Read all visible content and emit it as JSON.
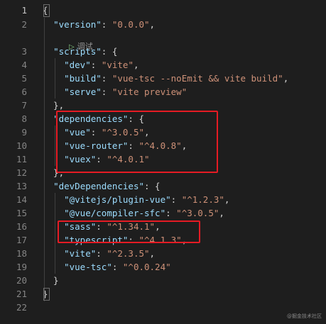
{
  "editor": {
    "codelens_label": "调试",
    "watermark": "@掘金技术社区",
    "line_numbers": [
      "1",
      "2",
      "3",
      "4",
      "5",
      "6",
      "7",
      "8",
      "9",
      "10",
      "11",
      "12",
      "13",
      "14",
      "15",
      "16",
      "17",
      "18",
      "19",
      "20",
      "21",
      "22"
    ],
    "lines": [
      {
        "parts": [
          {
            "c": "p",
            "t": "{"
          }
        ]
      },
      {
        "parts": [
          {
            "c": "p",
            "t": "  "
          },
          {
            "c": "k",
            "t": "\"version\""
          },
          {
            "c": "p",
            "t": ": "
          },
          {
            "c": "s",
            "t": "\"0.0.0\""
          },
          {
            "c": "p",
            "t": ","
          }
        ]
      },
      {
        "parts": [
          {
            "c": "p",
            "t": "  "
          },
          {
            "c": "k",
            "t": "\"scripts\""
          },
          {
            "c": "p",
            "t": ": {"
          }
        ]
      },
      {
        "parts": [
          {
            "c": "p",
            "t": "    "
          },
          {
            "c": "k",
            "t": "\"dev\""
          },
          {
            "c": "p",
            "t": ": "
          },
          {
            "c": "s",
            "t": "\"vite\""
          },
          {
            "c": "p",
            "t": ","
          }
        ]
      },
      {
        "parts": [
          {
            "c": "p",
            "t": "    "
          },
          {
            "c": "k",
            "t": "\"build\""
          },
          {
            "c": "p",
            "t": ": "
          },
          {
            "c": "s",
            "t": "\"vue-tsc --noEmit && vite build\""
          },
          {
            "c": "p",
            "t": ","
          }
        ]
      },
      {
        "parts": [
          {
            "c": "p",
            "t": "    "
          },
          {
            "c": "k",
            "t": "\"serve\""
          },
          {
            "c": "p",
            "t": ": "
          },
          {
            "c": "s",
            "t": "\"vite preview\""
          }
        ]
      },
      {
        "parts": [
          {
            "c": "p",
            "t": "  },"
          }
        ]
      },
      {
        "parts": [
          {
            "c": "p",
            "t": "  "
          },
          {
            "c": "k",
            "t": "\"dependencies\""
          },
          {
            "c": "p",
            "t": ": {"
          }
        ]
      },
      {
        "parts": [
          {
            "c": "p",
            "t": "    "
          },
          {
            "c": "k",
            "t": "\"vue\""
          },
          {
            "c": "p",
            "t": ": "
          },
          {
            "c": "s",
            "t": "\"^3.0.5\""
          },
          {
            "c": "p",
            "t": ","
          }
        ]
      },
      {
        "parts": [
          {
            "c": "p",
            "t": "    "
          },
          {
            "c": "k",
            "t": "\"vue-router\""
          },
          {
            "c": "p",
            "t": ": "
          },
          {
            "c": "s",
            "t": "\"^4.0.8\""
          },
          {
            "c": "p",
            "t": ","
          }
        ]
      },
      {
        "parts": [
          {
            "c": "p",
            "t": "    "
          },
          {
            "c": "k",
            "t": "\"vuex\""
          },
          {
            "c": "p",
            "t": ": "
          },
          {
            "c": "s",
            "t": "\"^4.0.1\""
          }
        ]
      },
      {
        "parts": [
          {
            "c": "p",
            "t": "  },"
          }
        ]
      },
      {
        "parts": [
          {
            "c": "p",
            "t": "  "
          },
          {
            "c": "k",
            "t": "\"devDependencies\""
          },
          {
            "c": "p",
            "t": ": {"
          }
        ]
      },
      {
        "parts": [
          {
            "c": "p",
            "t": "    "
          },
          {
            "c": "k",
            "t": "\"@vitejs/plugin-vue\""
          },
          {
            "c": "p",
            "t": ": "
          },
          {
            "c": "s",
            "t": "\"^1.2.3\""
          },
          {
            "c": "p",
            "t": ","
          }
        ]
      },
      {
        "parts": [
          {
            "c": "p",
            "t": "    "
          },
          {
            "c": "k",
            "t": "\"@vue/compiler-sfc\""
          },
          {
            "c": "p",
            "t": ": "
          },
          {
            "c": "s",
            "t": "\"^3.0.5\""
          },
          {
            "c": "p",
            "t": ","
          }
        ]
      },
      {
        "parts": [
          {
            "c": "p",
            "t": "    "
          },
          {
            "c": "k",
            "t": "\"sass\""
          },
          {
            "c": "p",
            "t": ": "
          },
          {
            "c": "s",
            "t": "\"^1.34.1\""
          },
          {
            "c": "p",
            "t": ","
          }
        ]
      },
      {
        "parts": [
          {
            "c": "p",
            "t": "    "
          },
          {
            "c": "k",
            "t": "\"typescript\""
          },
          {
            "c": "p",
            "t": ": "
          },
          {
            "c": "s",
            "t": "\"^4.1.3\""
          },
          {
            "c": "p",
            "t": ","
          }
        ]
      },
      {
        "parts": [
          {
            "c": "p",
            "t": "    "
          },
          {
            "c": "k",
            "t": "\"vite\""
          },
          {
            "c": "p",
            "t": ": "
          },
          {
            "c": "s",
            "t": "\"^2.3.5\""
          },
          {
            "c": "p",
            "t": ","
          }
        ]
      },
      {
        "parts": [
          {
            "c": "p",
            "t": "    "
          },
          {
            "c": "k",
            "t": "\"vue-tsc\""
          },
          {
            "c": "p",
            "t": ": "
          },
          {
            "c": "s",
            "t": "\"^0.0.24\""
          }
        ]
      },
      {
        "parts": [
          {
            "c": "p",
            "t": "  }"
          }
        ]
      },
      {
        "parts": [
          {
            "c": "p",
            "t": "}"
          }
        ]
      },
      {
        "parts": []
      }
    ]
  },
  "colors": {
    "background": "#1e1e1e",
    "key": "#9cdcfe",
    "string": "#ce9178",
    "punctuation": "#d4d4d4",
    "line_number": "#858585",
    "annotation_box": "#e51b24"
  }
}
